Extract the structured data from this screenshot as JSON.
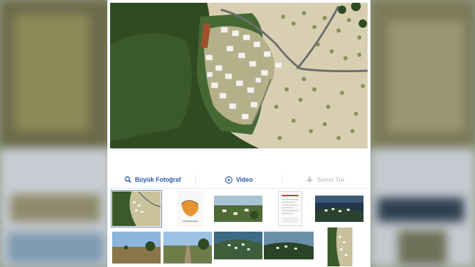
{
  "tabs": {
    "photo_label": "Büyük Fotoğraf",
    "photo_icon": "search-icon",
    "video_label": "Video",
    "video_icon": "play-circle-icon",
    "virtual_tour_label": "Sanal Tur",
    "virtual_tour_icon": "virtual-tour-icon"
  },
  "colors": {
    "tab_active": "#2e57a8",
    "tab_disabled": "#c9ccd2",
    "thumb_border": "#6f87b8"
  },
  "thumbnails": {
    "row1": [
      "aerial-site-photo",
      "site-plan-map",
      "landscape-render",
      "document-page",
      "night-aerial-render"
    ],
    "row2": [
      "countryside-photo",
      "field-road-photo",
      "aerial-blue-render",
      "aerial-evening-render",
      "portrait-aerial-render"
    ]
  }
}
